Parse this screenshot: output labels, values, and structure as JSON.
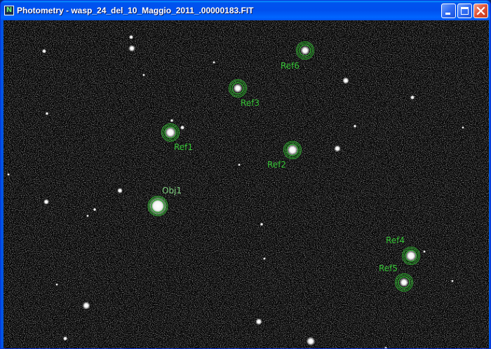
{
  "window": {
    "title": "Photometry - wasp_24_del_10_Maggio_2011_.00000183.FIT",
    "app_icon": "N",
    "controls": [
      "minimize-icon",
      "maximize-icon",
      "close-icon"
    ]
  },
  "image": {
    "description_of_content": "star-field",
    "apertures": [
      {
        "label": "Ref6",
        "kind": "reference"
      },
      {
        "label": "Ref3",
        "kind": "reference"
      },
      {
        "label": "Ref1",
        "kind": "reference"
      },
      {
        "label": "Ref2",
        "kind": "reference"
      },
      {
        "label": "Obj1",
        "kind": "object"
      },
      {
        "label": "Ref4",
        "kind": "reference"
      },
      {
        "label": "Ref5",
        "kind": "reference"
      }
    ]
  },
  "colors": {
    "title_bar": "#0054e3",
    "aperture_ring": "#2ea82e",
    "label_ref": "#35c435",
    "label_obj": "#7fd07f"
  }
}
